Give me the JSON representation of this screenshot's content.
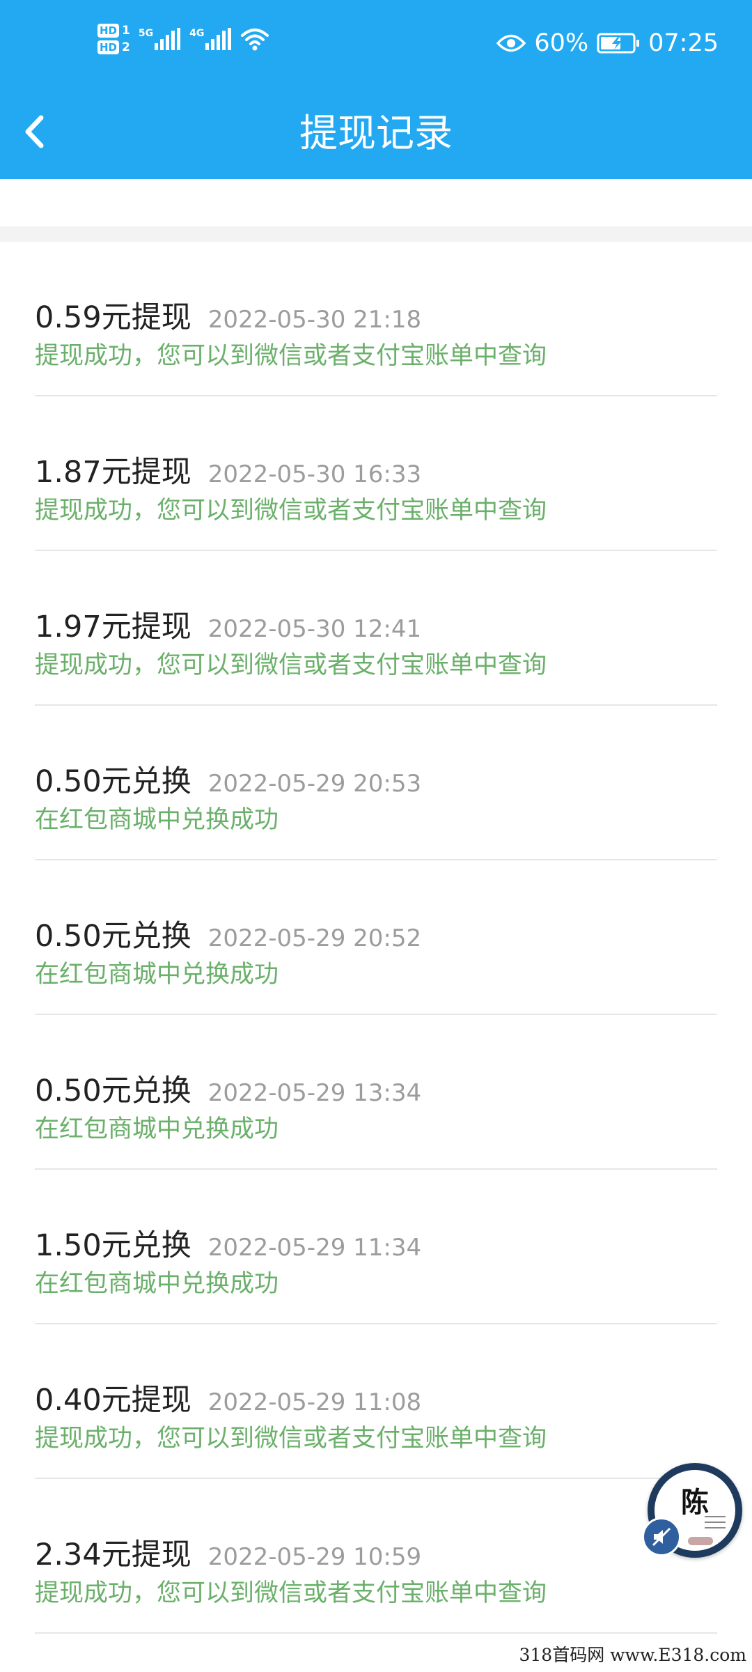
{
  "status_bar": {
    "hd_badge": "HD",
    "sim1": "1",
    "sim2": "2",
    "net1": "5G",
    "net2": "4G",
    "battery": "60%",
    "time": "07:25",
    "icons": [
      "sim-hd-icon",
      "signal-icon",
      "wifi-icon",
      "eye-icon",
      "battery-charging-icon"
    ]
  },
  "header": {
    "title": "提现记录",
    "back_icon": "chevron-left-icon",
    "color": "#23a9f2"
  },
  "records": [
    {
      "amount": "0.59元提现",
      "time": "2022-05-30 21:18",
      "desc": "提现成功，您可以到微信或者支付宝账单中查询"
    },
    {
      "amount": "1.87元提现",
      "time": "2022-05-30 16:33",
      "desc": "提现成功，您可以到微信或者支付宝账单中查询"
    },
    {
      "amount": "1.97元提现",
      "time": "2022-05-30 12:41",
      "desc": "提现成功，您可以到微信或者支付宝账单中查询"
    },
    {
      "amount": "0.50元兑换",
      "time": "2022-05-29 20:53",
      "desc": "在红包商城中兑换成功"
    },
    {
      "amount": "0.50元兑换",
      "time": "2022-05-29 20:52",
      "desc": "在红包商城中兑换成功"
    },
    {
      "amount": "0.50元兑换",
      "time": "2022-05-29 13:34",
      "desc": "在红包商城中兑换成功"
    },
    {
      "amount": "1.50元兑换",
      "time": "2022-05-29 11:34",
      "desc": "在红包商城中兑换成功"
    },
    {
      "amount": "0.40元提现",
      "time": "2022-05-29 11:08",
      "desc": "提现成功，您可以到微信或者支付宝账单中查询"
    },
    {
      "amount": "2.34元提现",
      "time": "2022-05-29 10:59",
      "desc": "提现成功，您可以到微信或者支付宝账单中查询"
    }
  ],
  "colors": {
    "success_text": "#6ab06a",
    "time_text": "#9c9c9c",
    "amount_text": "#222222"
  },
  "floating_avatar": {
    "seal_char": "陈",
    "badge_icon": "muted-speaker-icon"
  },
  "watermark": "318首码网 www.E318.com"
}
